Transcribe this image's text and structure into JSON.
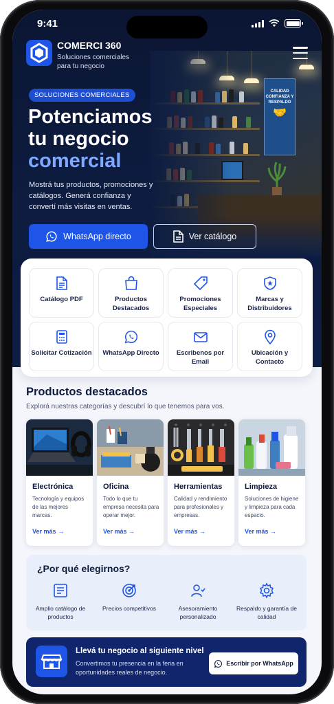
{
  "status_bar": {
    "time": "9:41"
  },
  "header": {
    "brand_name": "COMERCI 360",
    "brand_tagline": "Soluciones comerciales para tu negocio"
  },
  "hero": {
    "badge": "SOLUCIONES COMERCIALES",
    "headline_line1": "Potenciamos",
    "headline_line2": "tu negocio",
    "headline_accent": "comercial",
    "description": "Mostrá tus productos, promociones y catálogos. Generá confianza y convertí más visitas en ventas.",
    "primary_button": "WhatsApp directo",
    "secondary_button": "Ver catálogo",
    "poster_text": "CALIDAD CONFIANZA Y RESPALDO"
  },
  "quick_actions": [
    {
      "label": "Catálogo PDF",
      "icon": "document-icon"
    },
    {
      "label": "Productos Destacados",
      "icon": "shopping-bag-icon"
    },
    {
      "label": "Promociones Especiales",
      "icon": "tag-icon"
    },
    {
      "label": "Marcas y Distribuidores",
      "icon": "shield-star-icon"
    },
    {
      "label": "Solicitar Cotización",
      "icon": "calculator-icon"
    },
    {
      "label": "WhatsApp Directo",
      "icon": "whatsapp-icon"
    },
    {
      "label": "Escribenos por Email",
      "icon": "mail-icon"
    },
    {
      "label": "Ubicación y Contacto",
      "icon": "location-pin-icon"
    }
  ],
  "products": {
    "title": "Productos destacados",
    "subtitle": "Explorá nuestras categorías y descubrí lo que tenemos para vos.",
    "items": [
      {
        "title": "Electrónica",
        "description": "Tecnología y equipos de las mejores marcas.",
        "link": "Ver más →"
      },
      {
        "title": "Oficina",
        "description": "Todo lo que tu empresa necesita para operar mejor.",
        "link": "Ver más →"
      },
      {
        "title": "Herramientas",
        "description": "Calidad y rendimiento para profesionales y empresas.",
        "link": "Ver más →"
      },
      {
        "title": "Limpieza",
        "description": "Soluciones de higiene y limpieza para cada espacio.",
        "link": "Ver más →"
      }
    ]
  },
  "why": {
    "title": "¿Por qué elegirnos?",
    "items": [
      {
        "label": "Amplio catálogo de productos",
        "icon": "catalog-icon"
      },
      {
        "label": "Precios competitivos",
        "icon": "target-icon"
      },
      {
        "label": "Asesoramiento personalizado",
        "icon": "user-support-icon"
      },
      {
        "label": "Respaldo y garantía de calidad",
        "icon": "gear-icon"
      }
    ]
  },
  "cta": {
    "title": "Llevá tu negocio al siguiente nivel",
    "description": "Convertimos tu presencia en la feria en oportunidades reales de negocio.",
    "button": "Escribir por WhatsApp"
  },
  "colors": {
    "accent": "#1f55e6",
    "hero_bg": "#0b1633",
    "accent_light": "#7fa9ff",
    "cta_bg": "#10256b"
  }
}
